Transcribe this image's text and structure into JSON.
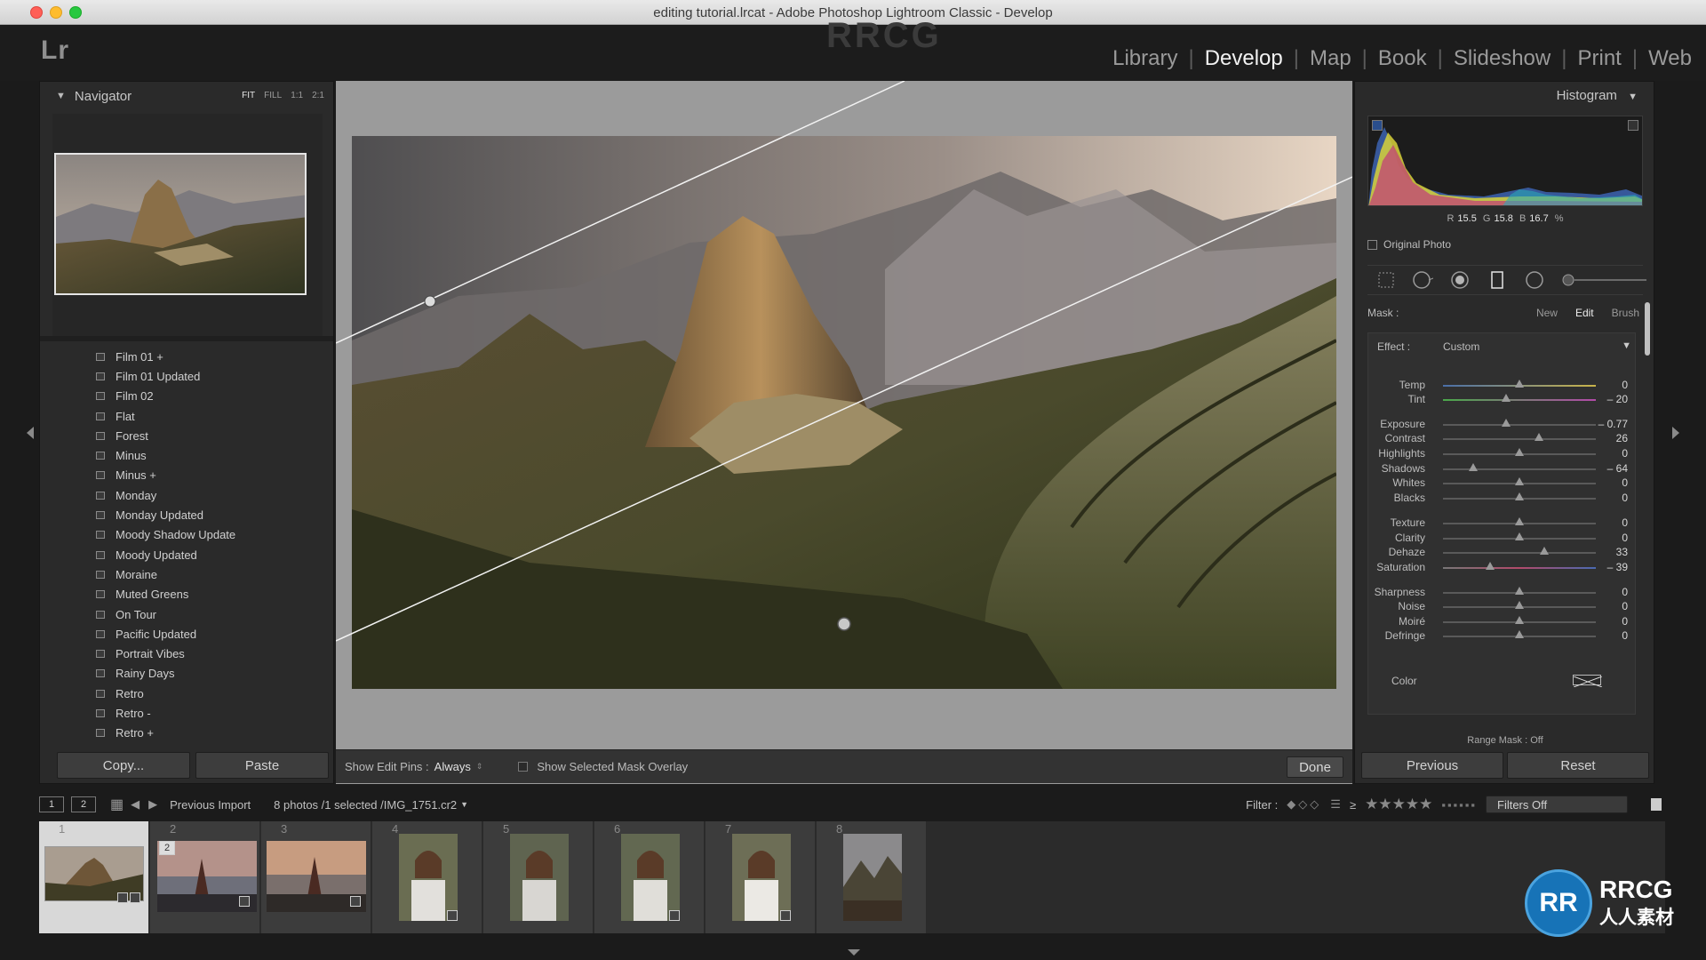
{
  "window": {
    "title": "editing tutorial.lrcat - Adobe Photoshop Lightroom Classic - Develop"
  },
  "app": {
    "logo": "Lr",
    "modules": [
      "Library",
      "Develop",
      "Map",
      "Book",
      "Slideshow",
      "Print",
      "Web"
    ],
    "active_module": "Develop"
  },
  "navigator": {
    "title": "Navigator",
    "zoom_options": [
      "FIT",
      "FILL",
      "1:1",
      "2:1"
    ],
    "active_zoom": "FIT"
  },
  "presets": [
    "Film 01 +",
    "Film 01 Updated",
    "Film 02",
    "Flat",
    "Forest",
    "Minus",
    "Minus +",
    "Monday",
    "Monday Updated",
    "Moody Shadow Update",
    "Moody Updated",
    "Moraine",
    "Muted Greens",
    "On Tour",
    "Pacific Updated",
    "Portrait Vibes",
    "Rainy Days",
    "Retro",
    "Retro -",
    "Retro +"
  ],
  "left_buttons": {
    "copy": "Copy...",
    "paste": "Paste"
  },
  "toolbar": {
    "show_edit_pins_label": "Show Edit Pins :",
    "show_edit_pins_value": "Always",
    "mask_overlay_label": "Show Selected Mask Overlay",
    "done": "Done"
  },
  "histogram": {
    "title": "Histogram",
    "r_label": "R",
    "r_value": "15.5",
    "g_label": "G",
    "g_value": "15.8",
    "b_label": "B",
    "b_value": "16.7",
    "unit": "%",
    "original_photo": "Original Photo"
  },
  "mask": {
    "label": "Mask :",
    "options": [
      "New",
      "Edit",
      "Brush"
    ],
    "active": "Edit"
  },
  "effect": {
    "label": "Effect :",
    "value": "Custom",
    "sliders": [
      {
        "name": "Temp",
        "value": "0",
        "pos": 0.5
      },
      {
        "name": "Tint",
        "value": "– 20",
        "pos": 0.41
      },
      {
        "name": "Exposure",
        "value": "– 0.77",
        "pos": 0.41
      },
      {
        "name": "Contrast",
        "value": "26",
        "pos": 0.63
      },
      {
        "name": "Highlights",
        "value": "0",
        "pos": 0.5
      },
      {
        "name": "Shadows",
        "value": "– 64",
        "pos": 0.2
      },
      {
        "name": "Whites",
        "value": "0",
        "pos": 0.5
      },
      {
        "name": "Blacks",
        "value": "0",
        "pos": 0.5
      },
      {
        "name": "Texture",
        "value": "0",
        "pos": 0.5
      },
      {
        "name": "Clarity",
        "value": "0",
        "pos": 0.5
      },
      {
        "name": "Dehaze",
        "value": "33",
        "pos": 0.66
      },
      {
        "name": "Saturation",
        "value": "– 39",
        "pos": 0.31
      },
      {
        "name": "Sharpness",
        "value": "0",
        "pos": 0.5
      },
      {
        "name": "Noise",
        "value": "0",
        "pos": 0.5
      },
      {
        "name": "Moiré",
        "value": "0",
        "pos": 0.5
      },
      {
        "name": "Defringe",
        "value": "0",
        "pos": 0.5
      }
    ],
    "color_label": "Color",
    "range_mask": "Range Mask : Off"
  },
  "right_buttons": {
    "previous": "Previous",
    "reset": "Reset"
  },
  "filmstrip_bar": {
    "screen1": "1",
    "screen2": "2",
    "source": "Previous Import",
    "count": "8 photos /1 selected /IMG_1751.cr2",
    "filter_label": "Filter :",
    "rating_op": "≥",
    "filters_off": "Filters Off"
  },
  "filmstrip": {
    "cells": [
      {
        "num": "1",
        "selected": true
      },
      {
        "num": "2",
        "selected": false
      },
      {
        "num": "3",
        "selected": false
      },
      {
        "num": "4",
        "selected": false
      },
      {
        "num": "5",
        "selected": false
      },
      {
        "num": "6",
        "selected": false
      },
      {
        "num": "7",
        "selected": false
      },
      {
        "num": "8",
        "selected": false
      }
    ],
    "stack_badge": "2"
  },
  "watermark": {
    "logo_letters": "RR",
    "brand": "RRCG",
    "brand_sub": "人人素材",
    "overlay_text": "RRCG"
  },
  "colors": {
    "accent_blue": "#1773b7",
    "panel_bg": "#2a2a2a",
    "center_bg": "#9b9b9b"
  }
}
